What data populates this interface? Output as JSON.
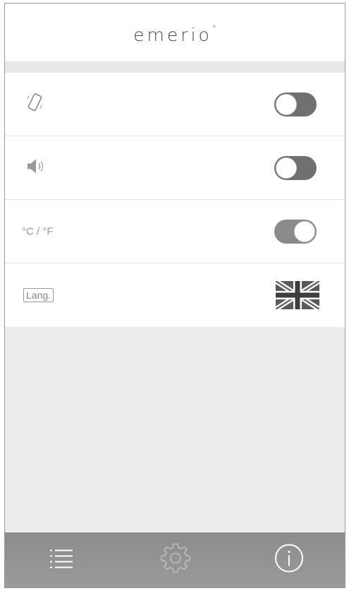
{
  "app": {
    "logo": "emerio",
    "logo_mark": "®"
  },
  "settings": [
    {
      "key": "vibration",
      "icon": "phone-vibrate-icon",
      "toggle_on": false
    },
    {
      "key": "sound",
      "icon": "speaker-icon",
      "toggle_on": false
    },
    {
      "key": "unit",
      "label": "°C / °F",
      "toggle_on": true
    },
    {
      "key": "language",
      "label": "Lang.",
      "flag_icon": "uk-flag-icon"
    }
  ],
  "nav": {
    "items": [
      "list-icon",
      "gear-icon",
      "info-icon"
    ]
  },
  "colors": {
    "toggle_track": "#707070",
    "footer": "#8c8c8c",
    "background": "#ececec"
  }
}
